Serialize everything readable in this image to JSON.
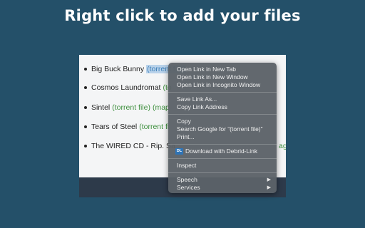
{
  "headline": "Right click to add your files",
  "page": {
    "items": [
      {
        "title": "Big Buck Bunny",
        "links": [
          "(torrent file)"
        ],
        "selected": 0
      },
      {
        "title": "Cosmos Laundromat",
        "links": [
          "(to"
        ]
      },
      {
        "title": "Sintel",
        "links": [
          "(torrent file)",
          "(map"
        ]
      },
      {
        "title": "Tears of Steel",
        "links": [
          "(torrent fi"
        ]
      },
      {
        "title": "The WIRED CD - Rip. Sa",
        "links": [
          "ag"
        ]
      }
    ]
  },
  "context_menu": {
    "items": [
      {
        "label": "Open Link in New Tab"
      },
      {
        "label": "Open Link in New Window"
      },
      {
        "label": "Open Link in Incognito Window"
      },
      {
        "label": "Save Link As..."
      },
      {
        "label": "Copy Link Address"
      },
      {
        "label": "Copy"
      },
      {
        "label": "Search Google for “(torrent file)”"
      },
      {
        "label": "Print..."
      },
      {
        "label": "Download with Debrid-Link",
        "badge": "DL",
        "icon": "debrid-link-icon"
      },
      {
        "label": "Inspect"
      },
      {
        "label": "Speech",
        "submenu_icon": "chevron-right-icon"
      },
      {
        "label": "Services",
        "submenu_icon": "chevron-right-icon"
      }
    ],
    "arrow_glyph": "▶"
  },
  "colors": {
    "background": "#245069",
    "link_green": "#3d8f3d",
    "menu_bg": "#5c6268",
    "debrid_blue": "#2f74b6"
  }
}
